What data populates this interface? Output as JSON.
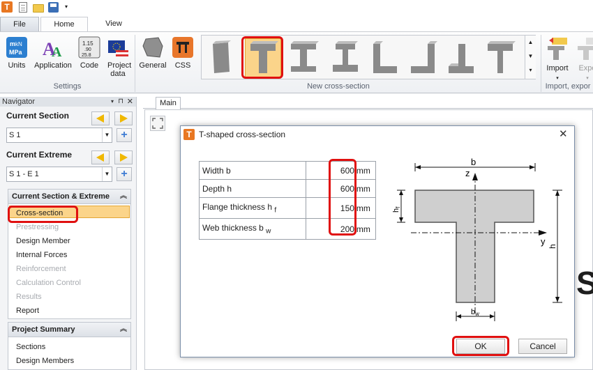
{
  "app": {
    "logo": "T"
  },
  "menu": {
    "file": "File",
    "home": "Home",
    "view": "View"
  },
  "ribbon": {
    "settings": {
      "units": "Units",
      "application": "Application",
      "code": "Code",
      "project_data": "Project data",
      "group": "Settings"
    },
    "new_cs": {
      "general": "General",
      "css": "CSS",
      "group": "New cross-section"
    },
    "import": {
      "import": "Import",
      "export": "Expo",
      "group": "Import, expor"
    }
  },
  "navigator": {
    "title": "Navigator",
    "current_section_label": "Current Section",
    "current_section_value": "S 1",
    "current_extreme_label": "Current Extreme",
    "current_extreme_value": "S 1 - E 1",
    "cse_header": "Current Section & Extreme",
    "cse_items": [
      "Cross-section",
      "Prestressing",
      "Design Member",
      "Internal Forces",
      "Reinforcement",
      "Calculation Control",
      "Results",
      "Report"
    ],
    "ps_header": "Project Summary",
    "ps_items": [
      "Sections",
      "Design Members"
    ]
  },
  "main": {
    "tab": "Main",
    "overflow_letter": "S"
  },
  "dialog": {
    "title": "T-shaped cross-section",
    "rows": [
      {
        "label": "Width b",
        "sub": "",
        "value": "600",
        "unit": "mm"
      },
      {
        "label": "Depth h",
        "sub": "",
        "value": "600",
        "unit": "mm"
      },
      {
        "label": "Flange thickness h",
        "sub": "f",
        "value": "150",
        "unit": "mm"
      },
      {
        "label": "Web thickness b",
        "sub": "w",
        "value": "200",
        "unit": "mm"
      }
    ],
    "diagram": {
      "b": "b",
      "z": "z",
      "y": "y",
      "h": "h",
      "hf": "h",
      "hf_sub": "f",
      "bw": "b",
      "bw_sub": "w"
    },
    "ok": "OK",
    "cancel": "Cancel"
  },
  "colors": {
    "accent": "#e87722",
    "highlight": "#e01010",
    "selected": "#fbd48a"
  }
}
